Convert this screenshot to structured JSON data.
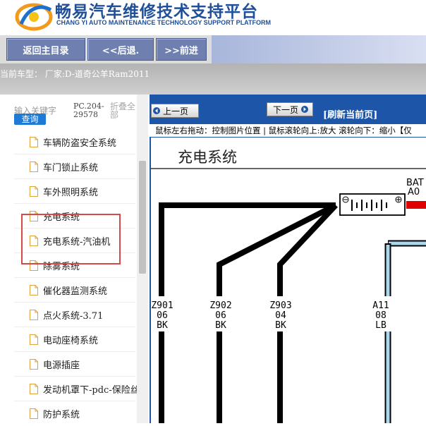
{
  "header": {
    "title_cn": "畅易汽车维修技术支持平台",
    "title_en": "CHANG YI AUTO MAINTENANCE TECHNOLOGY SUPPORT PLATFORM"
  },
  "nav": {
    "home": "返回主目录",
    "back": "<<后退.",
    "forward": ">>前进"
  },
  "current_car": "当前车型： 厂家:D-道奇公羊Ram2011",
  "sidebar": {
    "search_label": "输入关键字",
    "query_button": "查询",
    "pc_code": "PC.204-29578",
    "collapse_all": "折叠全部",
    "items": [
      {
        "label": "车辆防盗安全系统"
      },
      {
        "label": "车门锁止系统"
      },
      {
        "label": "车外照明系统"
      },
      {
        "label": "充电系统"
      },
      {
        "label": "充电系统-汽油机"
      },
      {
        "label": "除雾系统"
      },
      {
        "label": "催化器监测系统"
      },
      {
        "label": "点火系统-3.71"
      },
      {
        "label": "电动座椅系统"
      },
      {
        "label": "电源插座"
      },
      {
        "label": "发动机罩下-pdc-保险丝"
      },
      {
        "label": "防护系统"
      }
    ]
  },
  "viewer": {
    "prev": "上一页",
    "next": "下一页",
    "refresh": "[刷新当前页]",
    "hint": "鼠标左右拖动：控制图片位置 | 鼠标滚轮向上:放大 滚轮向下：缩小【仅"
  },
  "diagram": {
    "title": "充电系统",
    "bat_label": "BAT",
    "bat_sub": "A0",
    "wires": [
      {
        "id": "Z901",
        "gauge": "06",
        "color": "BK"
      },
      {
        "id": "Z902",
        "gauge": "06",
        "color": "BK"
      },
      {
        "id": "Z903",
        "gauge": "04",
        "color": "BK"
      },
      {
        "id": "A11",
        "gauge": "08",
        "color": "LB"
      }
    ]
  },
  "colors": {
    "brand_blue": "#1f4f99",
    "panel_blue": "#1d56a8",
    "highlight_red": "#d44a4a"
  }
}
